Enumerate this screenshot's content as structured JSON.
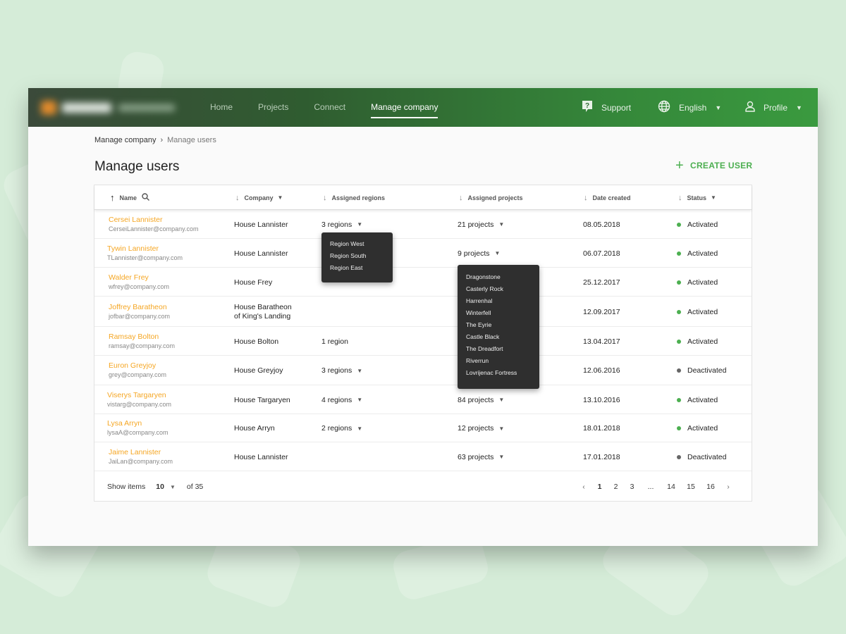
{
  "nav": {
    "items": [
      "Home",
      "Projects",
      "Connect",
      "Manage company"
    ],
    "active_index": 3,
    "support": "Support",
    "language": "English",
    "profile": "Profile"
  },
  "breadcrumb": {
    "parent": "Manage company",
    "current": "Manage users"
  },
  "page": {
    "title": "Manage users",
    "create_button": "CREATE USER"
  },
  "table": {
    "columns": {
      "name": "Name",
      "company": "Company",
      "regions": "Assigned regions",
      "projects": "Assigned projects",
      "date": "Date created",
      "status": "Status"
    },
    "rows": [
      {
        "name": "Cersei Lannister",
        "email": "CerseiLannister@company.com",
        "company": "House Lannister",
        "company2": "",
        "regions": "3 regions",
        "projects": "21 projects",
        "date": "08.05.2018",
        "status": "Activated"
      },
      {
        "name": "Tywin Lannister",
        "email": "TLannister@company.com",
        "company": "House Lannister",
        "company2": "",
        "regions": "",
        "projects": "9 projects",
        "date": "06.07.2018",
        "status": "Activated"
      },
      {
        "name": "Walder Frey",
        "email": "wfrey@company.com",
        "company": "House Frey",
        "company2": "",
        "regions": "",
        "projects": "",
        "date": "25.12.2017",
        "status": "Activated"
      },
      {
        "name": "Joffrey Baratheon",
        "email": "jofbar@company.com",
        "company": "House Baratheon",
        "company2": "of King's Landing",
        "regions": "",
        "projects": "",
        "date": "12.09.2017",
        "status": "Activated"
      },
      {
        "name": "Ramsay Bolton",
        "email": "ramsay@company.com",
        "company": "House Bolton",
        "company2": "",
        "regions": "1 region",
        "projects": "",
        "date": "13.04.2017",
        "status": "Activated"
      },
      {
        "name": "Euron Greyjoy",
        "email": "grey@company.com",
        "company": "House Greyjoy",
        "company2": "",
        "regions": "3 regions",
        "projects": "",
        "date": "12.06.2016",
        "status": "Deactivated"
      },
      {
        "name": "Viserys Targaryen",
        "email": "vistarg@company.com",
        "company": "House Targaryen",
        "company2": "",
        "regions": "4 regions",
        "projects": "84 projects",
        "date": "13.10.2016",
        "status": "Activated"
      },
      {
        "name": "Lysa Arryn",
        "email": "lysaA@company.com",
        "company": "House Arryn",
        "company2": "",
        "regions": "2 regions",
        "projects": "12 projects",
        "date": "18.01.2018",
        "status": "Activated"
      },
      {
        "name": "Jaime Lannister",
        "email": "JaiLan@company.com",
        "company": "House Lannister",
        "company2": "",
        "regions": "",
        "projects": "63 projects",
        "date": "17.01.2018",
        "status": "Deactivated"
      }
    ]
  },
  "regions_popup": [
    "Region West",
    "Region South",
    "Region East"
  ],
  "projects_popup": [
    "Dragonstone",
    "Casterly Rock",
    "Harrenhal",
    "Winterfell",
    "The Eyrie",
    "Castle Black",
    "The Dreadfort",
    "Riverrun",
    "Lovrijenac Fortress"
  ],
  "pagination": {
    "show_items_label": "Show items",
    "per_page": "10",
    "total": "of 35",
    "pages": [
      "1",
      "2",
      "3",
      "...",
      "14",
      "15",
      "16"
    ],
    "active": "1"
  },
  "colors": {
    "accent": "#4caf50",
    "name_link": "#f5a623",
    "status_active": "#4caf50",
    "status_inactive": "#666666",
    "popup_bg": "#2f2f2f"
  },
  "icons": [
    "support-icon",
    "globe-icon",
    "profile-icon",
    "search-icon",
    "plus-icon",
    "sort-arrow-icon",
    "caret-down-icon",
    "chevron-left-icon",
    "chevron-right-icon"
  ]
}
